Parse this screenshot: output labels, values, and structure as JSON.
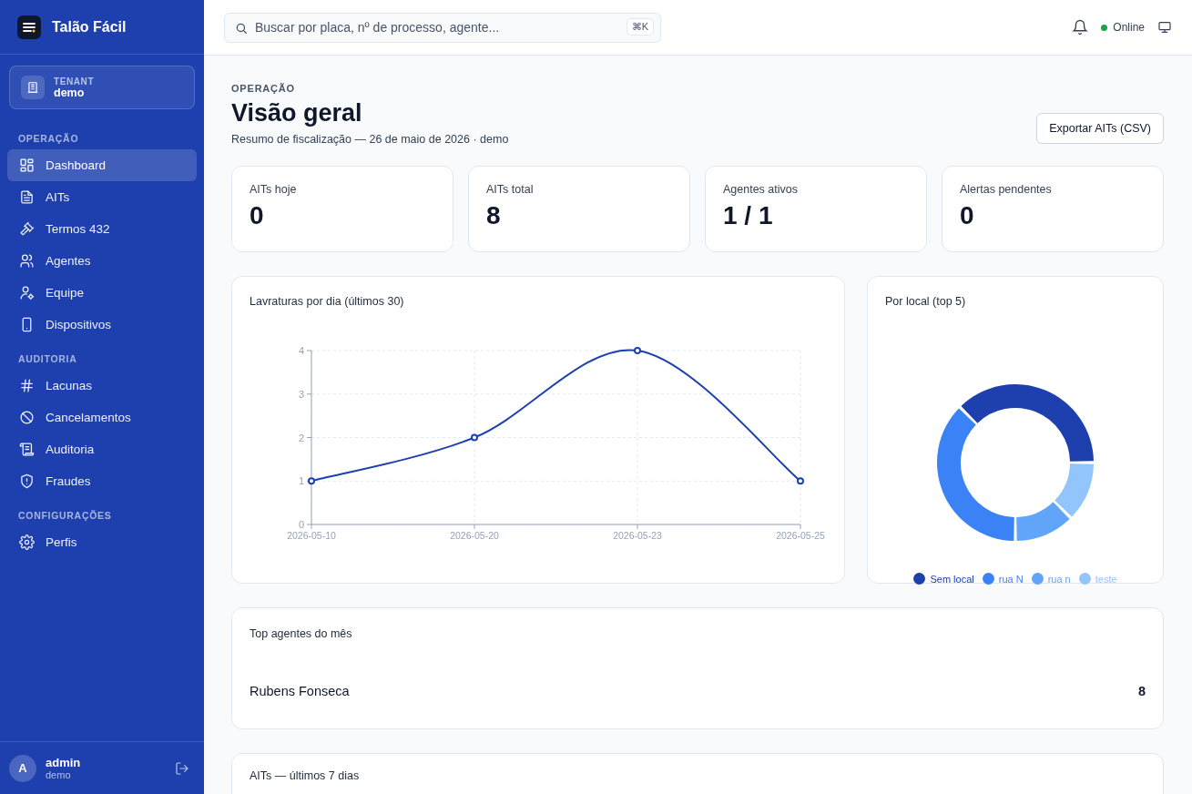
{
  "brand": {
    "name": "Talão Fácil"
  },
  "tenant": {
    "label": "TENANT",
    "value": "demo"
  },
  "nav": [
    {
      "heading": "OPERAÇÃO",
      "items": [
        {
          "label": "Dashboard",
          "selected": true
        },
        {
          "label": "AITs",
          "selected": false
        },
        {
          "label": "Termos 432",
          "selected": false
        },
        {
          "label": "Agentes",
          "selected": false
        },
        {
          "label": "Equipe",
          "selected": false
        },
        {
          "label": "Dispositivos",
          "selected": false
        }
      ]
    },
    {
      "heading": "AUDITORIA",
      "items": [
        {
          "label": "Lacunas",
          "selected": false
        },
        {
          "label": "Cancelamentos",
          "selected": false
        },
        {
          "label": "Auditoria",
          "selected": false
        },
        {
          "label": "Fraudes",
          "selected": false
        }
      ]
    },
    {
      "heading": "CONFIGURAÇÕES",
      "items": [
        {
          "label": "Perfis",
          "selected": false
        }
      ]
    }
  ],
  "user": {
    "initial": "A",
    "name": "admin",
    "tenant": "demo"
  },
  "search": {
    "placeholder": "Buscar por placa, nº de processo, agente...",
    "shortcut": "⌘K"
  },
  "status": {
    "label": "Online",
    "color": "#16a34a"
  },
  "header": {
    "eyebrow": "OPERAÇÃO",
    "title": "Visão geral",
    "subtitle": "Resumo de fiscalização — 26 de maio de 2026 · demo",
    "export_button": "Exportar AITs (CSV)"
  },
  "stats": [
    {
      "label": "AITs hoje",
      "value": "0"
    },
    {
      "label": "AITs total",
      "value": "8"
    },
    {
      "label": "Agentes ativos",
      "value": "1 / 1"
    },
    {
      "label": "Alertas pendentes",
      "value": "0"
    }
  ],
  "line_card": {
    "title": "Lavraturas por dia (últimos 30)",
    "chart_data": {
      "type": "line",
      "categories": [
        "2026-05-10",
        "2026-05-20",
        "2026-05-23",
        "2026-05-25"
      ],
      "values": [
        1,
        2,
        4,
        1
      ],
      "color": "#1e40af",
      "marker": true,
      "grid": true,
      "ylim": [
        0,
        4
      ],
      "yticks": [
        0,
        1,
        2,
        3,
        4
      ]
    }
  },
  "donut_card": {
    "title": "Por local (top 5)",
    "chart_data": {
      "type": "donut",
      "categories": [
        "Sem local",
        "rua N",
        "rua n",
        "teste"
      ],
      "values": [
        37.5,
        37.5,
        12.5,
        12.5
      ],
      "colors": [
        "#1e40af",
        "#3b82f6",
        "#60a5fa",
        "#93c5fd"
      ],
      "legend": "bottom"
    }
  },
  "top_agents": {
    "title": "Top agentes do mês",
    "rows": [
      {
        "name": "Rubens Fonseca",
        "count": "8"
      }
    ]
  },
  "recent_card": {
    "title": "AITs — últimos 7 dias"
  }
}
